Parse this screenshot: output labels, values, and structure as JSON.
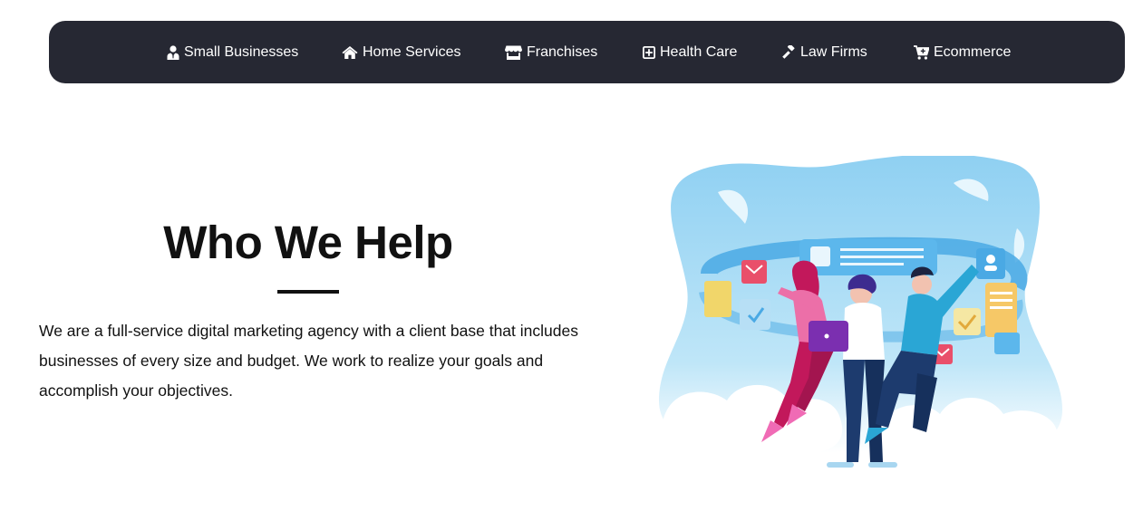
{
  "nav": {
    "items": [
      {
        "label": "Small Businesses",
        "icon": "user-tie-icon"
      },
      {
        "label": "Home Services",
        "icon": "home-icon"
      },
      {
        "label": "Franchises",
        "icon": "store-icon"
      },
      {
        "label": "Health Care",
        "icon": "plus-square-icon"
      },
      {
        "label": "Law Firms",
        "icon": "gavel-icon"
      },
      {
        "label": "Ecommerce",
        "icon": "cart-plus-icon"
      }
    ]
  },
  "hero": {
    "title": "Who We Help",
    "description": "We are a full-service digital marketing agency with a client base that includes businesses of every size and budget. We work to realize your goals and accomplish your objectives."
  },
  "colors": {
    "nav_background": "#262833",
    "nav_text": "#ffffff",
    "heading": "#111111",
    "illustration_sky": "#a9dcf5"
  }
}
